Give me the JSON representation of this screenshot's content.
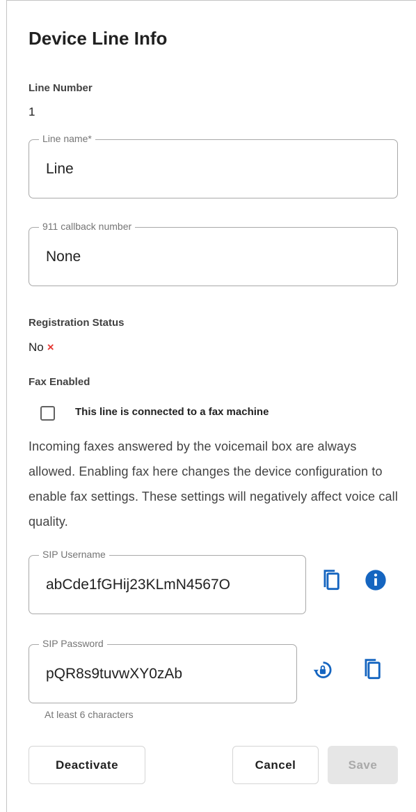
{
  "title": "Device Line Info",
  "line_number": {
    "label": "Line Number",
    "value": "1"
  },
  "line_name": {
    "legend": "Line name*",
    "value": "Line"
  },
  "callback_911": {
    "legend": "911 callback number",
    "value": "None"
  },
  "registration": {
    "label": "Registration Status",
    "value": "No",
    "icon": "×",
    "icon_name": "close-icon",
    "icon_color": "#e53935"
  },
  "fax": {
    "label": "Fax Enabled",
    "checkbox_label": "This line is connected to a fax machine",
    "checked": false,
    "description": "Incoming faxes answered by the voicemail box are always allowed. Enabling fax here changes the device configuration to enable fax settings. These settings will negatively affect voice call quality."
  },
  "sip_username": {
    "legend": "SIP Username",
    "value": "abCde1fGHij23KLmN4567O",
    "copy_icon": "copy-icon",
    "info_icon": "info-icon"
  },
  "sip_password": {
    "legend": "SIP Password",
    "value": "pQR8s9tuvwXY0zAb",
    "helper": "At least 6 characters",
    "reset_icon": "lock-reset-icon",
    "copy_icon": "copy-icon"
  },
  "actions": {
    "deactivate": "Deactivate",
    "cancel": "Cancel",
    "save": "Save",
    "save_disabled": true
  },
  "colors": {
    "accent": "#1565c0",
    "error": "#e53935"
  }
}
